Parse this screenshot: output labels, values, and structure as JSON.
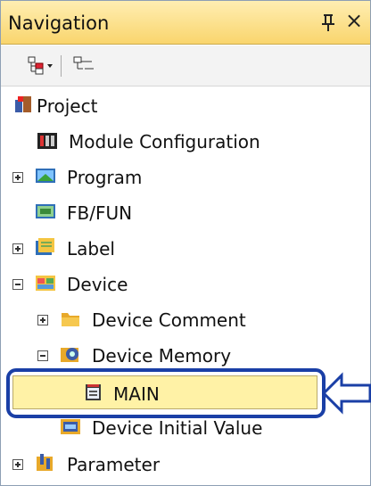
{
  "panel": {
    "title": "Navigation",
    "pin_glyph": "⨿",
    "close_glyph": "×"
  },
  "toolbar": {
    "buttons": [
      "tree-view-icon",
      "flat-view-icon"
    ]
  },
  "tree": {
    "items": [
      {
        "label": "Project",
        "icon": "project-icon",
        "expander": "none",
        "level": 0
      },
      {
        "label": "Module Configuration",
        "icon": "module-configuration-icon",
        "expander": "none",
        "level": 1
      },
      {
        "label": "Program",
        "icon": "program-icon",
        "expander": "plus",
        "level": 1
      },
      {
        "label": "FB/FUN",
        "icon": "fb-fun-icon",
        "expander": "none",
        "level": 1
      },
      {
        "label": "Label",
        "icon": "label-icon",
        "expander": "plus",
        "level": 1
      },
      {
        "label": "Device",
        "icon": "device-icon",
        "expander": "minus",
        "level": 1
      },
      {
        "label": "Device Comment",
        "icon": "folder-icon",
        "expander": "plus",
        "level": 2
      },
      {
        "label": "Device Memory",
        "icon": "device-memory-icon",
        "expander": "minus",
        "level": 2
      },
      {
        "label": "MAIN",
        "icon": "memory-file-icon",
        "expander": "none",
        "level": 3,
        "selected": true
      },
      {
        "label": "Device Initial Value",
        "icon": "device-initial-value-icon",
        "expander": "none",
        "level": 3
      },
      {
        "label": "Parameter",
        "icon": "parameter-icon",
        "expander": "plus",
        "level": 1
      }
    ]
  },
  "callout": {
    "color": "#1a3fa6",
    "target": "MAIN"
  },
  "colors": {
    "title_bar": "#f9d56d",
    "selection": "#fff2a6",
    "callout": "#1a3fa6"
  }
}
